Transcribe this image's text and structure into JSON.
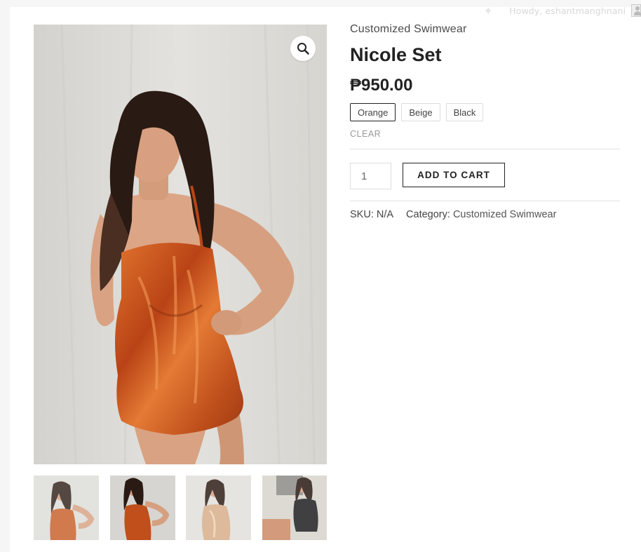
{
  "admin_bar": {
    "greeting": "Howdy, eshantmanghnani",
    "icons": {
      "sparkle": "sparkle-icon",
      "avatar": "avatar-icon"
    }
  },
  "gallery": {
    "zoom_icon": "magnifier-icon",
    "main_image": "woman in orange satin halter dress",
    "thumbnails": [
      "orange dress front thumbnail",
      "orange dress pose thumbnail",
      "beige dress thumbnail",
      "black dress thumbnail"
    ]
  },
  "product": {
    "category_heading": "Customized Swimwear",
    "title": "Nicole Set",
    "price": "₱950.00",
    "variations": {
      "options": [
        "Orange",
        "Beige",
        "Black"
      ],
      "selected": "Orange",
      "clear_label": "CLEAR"
    },
    "quantity": "1",
    "add_to_cart_label": "ADD TO CART",
    "meta": {
      "sku_label": "SKU:",
      "sku_value": "N/A",
      "category_label": "Category:",
      "category_value": "Customized Swimwear"
    }
  },
  "colors": {
    "text_dark": "#222222",
    "text_muted": "#999999",
    "border": "#dddddd",
    "satin_orange": "#c8501c"
  }
}
